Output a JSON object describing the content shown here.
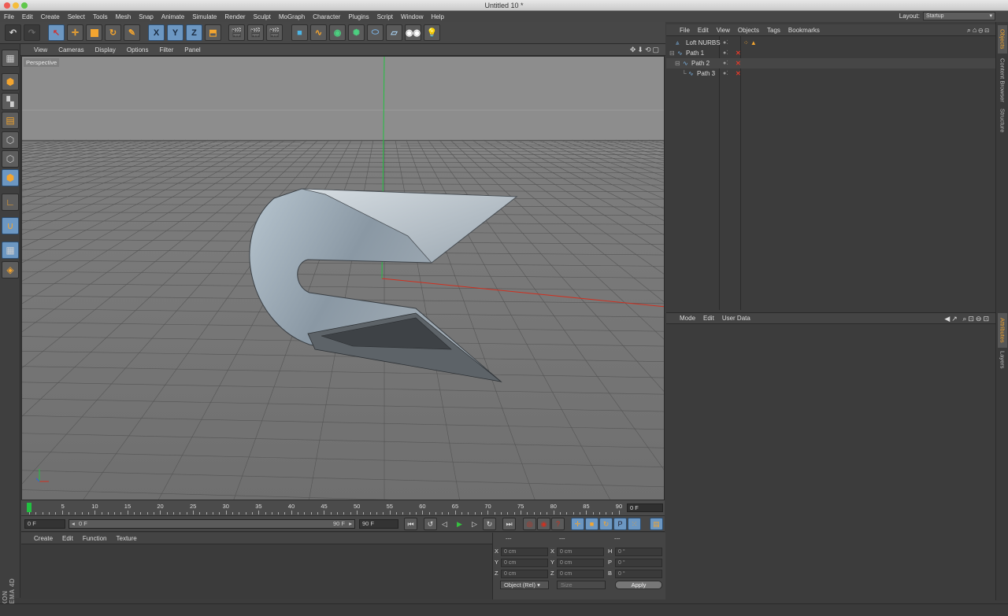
{
  "window": {
    "title": "Untitled 10 *"
  },
  "menubar": {
    "items": [
      "File",
      "Edit",
      "Create",
      "Select",
      "Tools",
      "Mesh",
      "Snap",
      "Animate",
      "Simulate",
      "Render",
      "Sculpt",
      "MoGraph",
      "Character",
      "Plugins",
      "Script",
      "Window",
      "Help"
    ],
    "layout_label": "Layout:",
    "layout_value": "Startup"
  },
  "viewport": {
    "menu": [
      "View",
      "Cameras",
      "Display",
      "Options",
      "Filter",
      "Panel"
    ],
    "camera_label": "Perspective"
  },
  "timeline": {
    "ticks": [
      "0",
      "5",
      "10",
      "15",
      "20",
      "25",
      "30",
      "35",
      "40",
      "45",
      "50",
      "55",
      "60",
      "65",
      "70",
      "75",
      "80",
      "85",
      "90"
    ],
    "current_frame_right": "0 F",
    "current_frame": "0 F",
    "range_start": "0 F",
    "range_end": "90 F",
    "max_frame": "90 F"
  },
  "material_manager": {
    "menu": [
      "Create",
      "Edit",
      "Function",
      "Texture"
    ]
  },
  "coordinates": {
    "headers": [
      "---",
      "---",
      "---"
    ],
    "rows": [
      {
        "a": "X",
        "av": "0 cm",
        "b": "X",
        "bv": "0 cm",
        "c": "H",
        "cv": "0 °"
      },
      {
        "a": "Y",
        "av": "0 cm",
        "b": "Y",
        "bv": "0 cm",
        "c": "P",
        "cv": "0 °"
      },
      {
        "a": "Z",
        "av": "0 cm",
        "b": "Z",
        "bv": "0 cm",
        "c": "B",
        "cv": "0 °"
      }
    ],
    "mode": "Object (Rel)",
    "size": "Size",
    "apply": "Apply"
  },
  "object_manager": {
    "menu": [
      "File",
      "Edit",
      "View",
      "Objects",
      "Tags",
      "Bookmarks"
    ],
    "objects": [
      {
        "name": "Loft NURBS",
        "indent": 0
      },
      {
        "name": "Path 1",
        "indent": 1
      },
      {
        "name": "Path 2",
        "indent": 1
      },
      {
        "name": "Path 3",
        "indent": 2
      }
    ]
  },
  "attribute_manager": {
    "menu": [
      "Mode",
      "Edit",
      "User Data"
    ]
  },
  "right_tabs": [
    "Objects",
    "Content Browser",
    "Structure",
    "Attributes",
    "Layers"
  ],
  "branding": "MAXON CINEMA 4D",
  "colors": {
    "accent": "#6c97c2",
    "orange": "#f3a530",
    "x_axis": "#d03020",
    "y_axis": "#20c040"
  }
}
